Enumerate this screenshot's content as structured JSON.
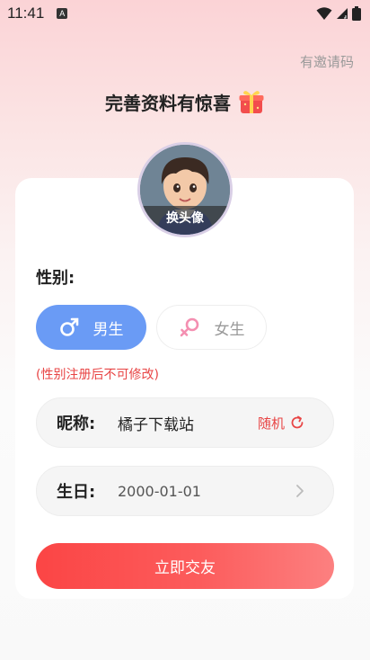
{
  "status_bar": {
    "time": "11:41",
    "notification_badge": "A"
  },
  "header": {
    "invite_code_label": "有邀请码",
    "title": "完善资料有惊喜",
    "gift_icon": "gift-icon"
  },
  "avatar": {
    "change_label": "换头像"
  },
  "gender": {
    "label": "性别:",
    "male_label": "男生",
    "female_label": "女生",
    "selected": "male",
    "note": "(性别注册后不可修改)"
  },
  "nickname": {
    "label": "昵称:",
    "value": "橘子下载站",
    "random_label": "随机"
  },
  "birthday": {
    "label": "生日:",
    "value": "2000-01-01"
  },
  "submit": {
    "label": "立即交友"
  },
  "colors": {
    "accent_red": "#fb4545",
    "male_blue": "#6a9bf5",
    "note_red": "#e84545",
    "female_pink": "#f48fb1"
  }
}
